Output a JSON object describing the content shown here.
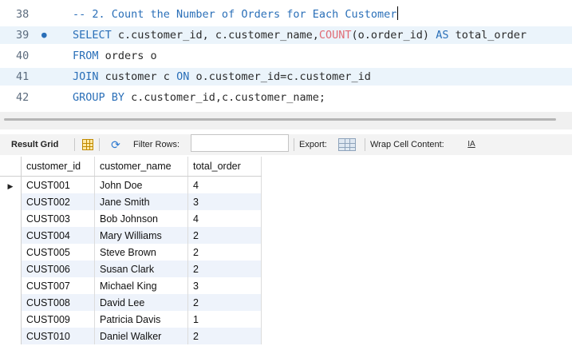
{
  "editor": {
    "lines": [
      {
        "num": "38",
        "marker": "",
        "segments": [
          {
            "t": "-- 2. Count the Number of Orders for Each Customer",
            "c": "cm"
          }
        ],
        "caret": true
      },
      {
        "num": "39",
        "marker": "●",
        "segments": [
          {
            "t": "SELECT",
            "c": "kw"
          },
          {
            "t": " c.customer_id, c.customer_name,",
            "c": ""
          },
          {
            "t": "COUNT",
            "c": "fn"
          },
          {
            "t": "(o.order_id) ",
            "c": ""
          },
          {
            "t": "AS",
            "c": "kw"
          },
          {
            "t": " total_order",
            "c": ""
          }
        ]
      },
      {
        "num": "40",
        "marker": "",
        "segments": [
          {
            "t": "FROM",
            "c": "kw"
          },
          {
            "t": " orders o",
            "c": ""
          }
        ]
      },
      {
        "num": "41",
        "marker": "",
        "segments": [
          {
            "t": "JOIN",
            "c": "kw"
          },
          {
            "t": " customer c ",
            "c": ""
          },
          {
            "t": "ON",
            "c": "kw"
          },
          {
            "t": " o.customer_id=c.customer_id",
            "c": ""
          }
        ]
      },
      {
        "num": "42",
        "marker": "",
        "segments": [
          {
            "t": "GROUP BY",
            "c": "kw"
          },
          {
            "t": " c.customer_id,c.customer_name;",
            "c": ""
          }
        ]
      }
    ]
  },
  "toolbar": {
    "result_grid_label": "Result Grid",
    "filter_rows_label": "Filter Rows:",
    "filter_value": "",
    "export_label": "Export:",
    "wrap_label": "Wrap Cell Content:",
    "refresh_icon": "refresh-icon",
    "grid_icon": "grid-icon",
    "export_icon": "export-icon",
    "wrap_icon": "wrap-icon"
  },
  "grid": {
    "columns": [
      "customer_id",
      "customer_name",
      "total_order"
    ],
    "rows": [
      [
        "CUST001",
        "John Doe",
        "4"
      ],
      [
        "CUST002",
        "Jane Smith",
        "3"
      ],
      [
        "CUST003",
        "Bob Johnson",
        "4"
      ],
      [
        "CUST004",
        "Mary Williams",
        "2"
      ],
      [
        "CUST005",
        "Steve Brown",
        "2"
      ],
      [
        "CUST006",
        "Susan Clark",
        "2"
      ],
      [
        "CUST007",
        "Michael King",
        "3"
      ],
      [
        "CUST008",
        "David Lee",
        "2"
      ],
      [
        "CUST009",
        "Patricia Davis",
        "1"
      ],
      [
        "CUST010",
        "Daniel Walker",
        "2"
      ]
    ],
    "selected_row_marker": "▶"
  }
}
